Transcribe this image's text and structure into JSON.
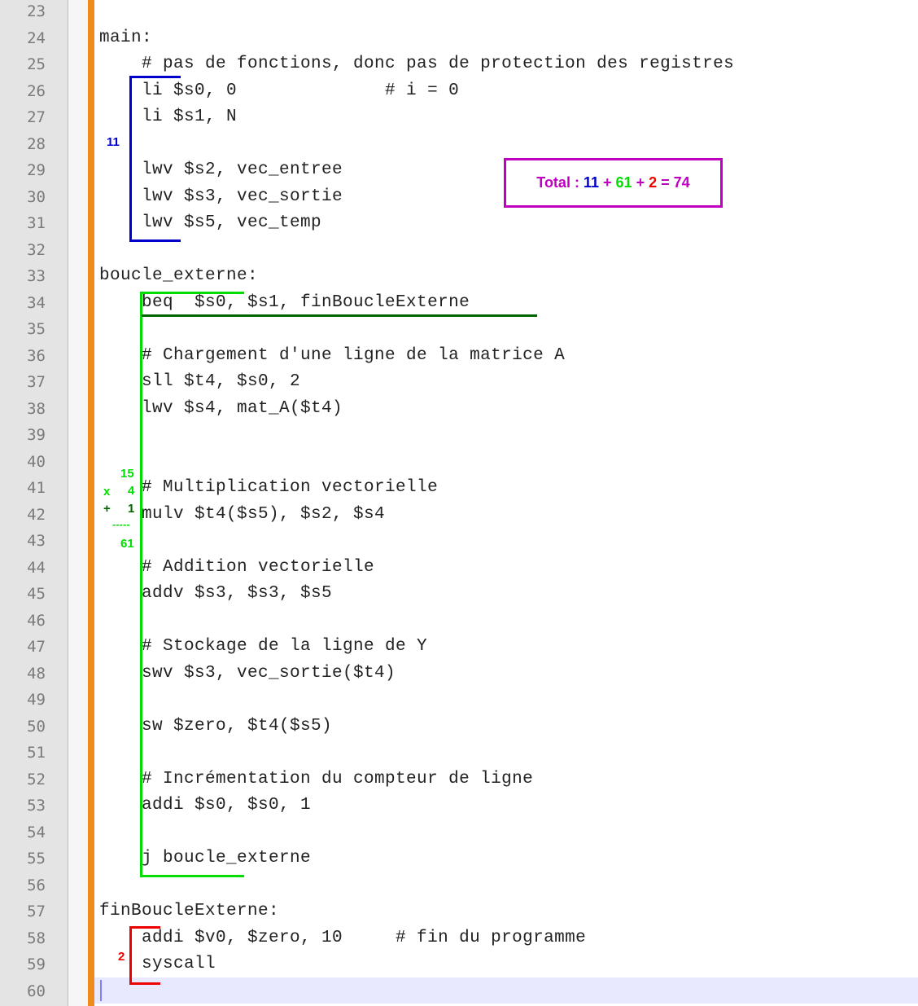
{
  "line_numbers": [
    "23",
    "24",
    "25",
    "26",
    "27",
    "28",
    "29",
    "30",
    "31",
    "32",
    "33",
    "34",
    "35",
    "36",
    "37",
    "38",
    "39",
    "40",
    "41",
    "42",
    "43",
    "44",
    "45",
    "46",
    "47",
    "48",
    "49",
    "50",
    "51",
    "52",
    "53",
    "54",
    "55",
    "56",
    "57",
    "58",
    "59",
    "60"
  ],
  "code_lines": [
    "",
    "main:",
    "    # pas de fonctions, donc pas de protection des registres",
    "    li $s0, 0              # i = 0",
    "    li $s1, N",
    "",
    "    lwv $s2, vec_entree",
    "    lwv $s3, vec_sortie",
    "    lwv $s5, vec_temp",
    "",
    "boucle_externe:",
    "    beq  $s0, $s1, finBoucleExterne",
    "",
    "    # Chargement d'une ligne de la matrice A",
    "    sll $t4, $s0, 2",
    "    lwv $s4, mat_A($t4)",
    "",
    "",
    "    # Multiplication vectorielle",
    "    mulv $t4($s5), $s2, $s4",
    "",
    "    # Addition vectorielle",
    "    addv $s3, $s3, $s5",
    "",
    "    # Stockage de la ligne de Y",
    "    swv $s3, vec_sortie($t4)",
    "",
    "    sw $zero, $t4($s5)",
    "",
    "    # Incrémentation du compteur de ligne",
    "    addi $s0, $s0, 1",
    "",
    "    j boucle_externe",
    "",
    "finBoucleExterne:",
    "    addi $v0, $zero, 10     # fin du programme",
    "    syscall",
    ""
  ],
  "annotations": {
    "blue_count": "11",
    "green_calc": {
      "a": "15",
      "times": "x",
      "b": "4",
      "plus": "+",
      "c": "1",
      "rule": "-----",
      "result": "61"
    },
    "red_count": "2",
    "total": {
      "label": "Total :",
      "blue": "11",
      "plus1": "+",
      "green": "61",
      "plus2": "+",
      "red": "2",
      "eq": "=",
      "sum": "74"
    }
  },
  "colors": {
    "blue": "#0000cc",
    "green": "#00dd00",
    "dark_green": "#006600",
    "red": "#ee0000",
    "magenta": "#c000c0",
    "change_bar": "#f08a1c"
  }
}
